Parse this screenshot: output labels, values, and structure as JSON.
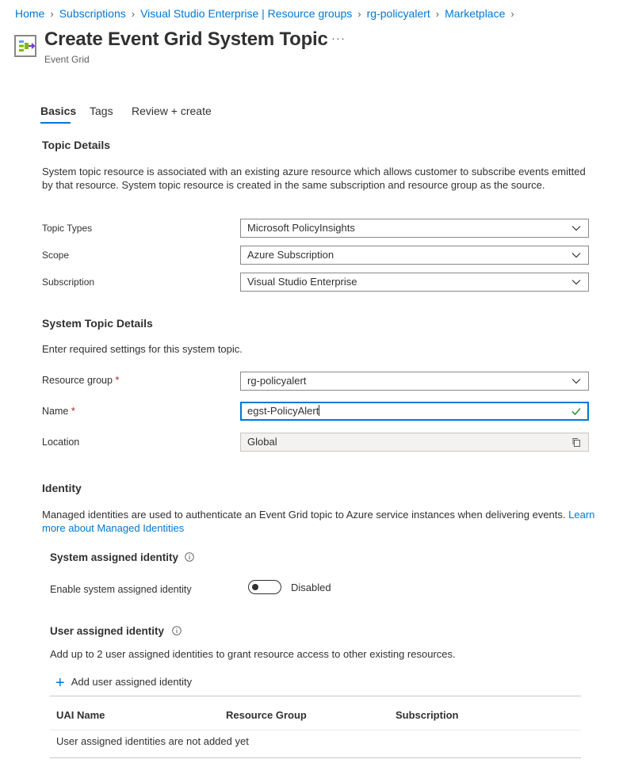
{
  "breadcrumb": [
    "Home",
    "Subscriptions",
    "Visual Studio Enterprise | Resource groups",
    "rg-policyalert",
    "Marketplace"
  ],
  "header": {
    "title": "Create Event Grid System Topic",
    "more": "···",
    "subtitle": "Event Grid"
  },
  "tabs": [
    "Basics",
    "Tags",
    "Review + create"
  ],
  "topic_details": {
    "title": "Topic Details",
    "description": "System topic resource is associated with an existing azure resource which allows customer to subscribe events emitted by that resource. System topic resource is created in the same subscription and resource group as the source.",
    "fields": [
      {
        "label": "Topic Types",
        "value": "Microsoft PolicyInsights"
      },
      {
        "label": "Scope",
        "value": "Azure Subscription"
      },
      {
        "label": "Subscription",
        "value": "Visual Studio Enterprise"
      }
    ]
  },
  "system_topic_details": {
    "title": "System Topic Details",
    "description": "Enter required settings for this system topic.",
    "resource_group": {
      "label": "Resource group",
      "value": "rg-policyalert"
    },
    "name": {
      "label": "Name",
      "value": "egst-PolicyAlert"
    },
    "location": {
      "label": "Location",
      "value": "Global"
    },
    "required_mark": "*"
  },
  "identity": {
    "title": "Identity",
    "description": "Managed identities are used to authenticate an Event Grid topic to Azure service instances when delivering events.",
    "learn_more": "Learn more about Managed Identities",
    "system_assigned": {
      "title": "System assigned identity",
      "toggle_label": "Enable system assigned identity",
      "toggle_state": "Disabled"
    },
    "user_assigned": {
      "title": "User assigned identity",
      "description": "Add up to 2 user assigned identities to grant resource access to other existing resources.",
      "add_button": "Add user assigned identity",
      "columns": [
        "UAI Name",
        "Resource Group",
        "Subscription"
      ],
      "empty_text": "User assigned identities are not added yet"
    }
  },
  "colors": {
    "accent": "#0078d4",
    "required": "#a4262c",
    "valid": "#107c10"
  }
}
